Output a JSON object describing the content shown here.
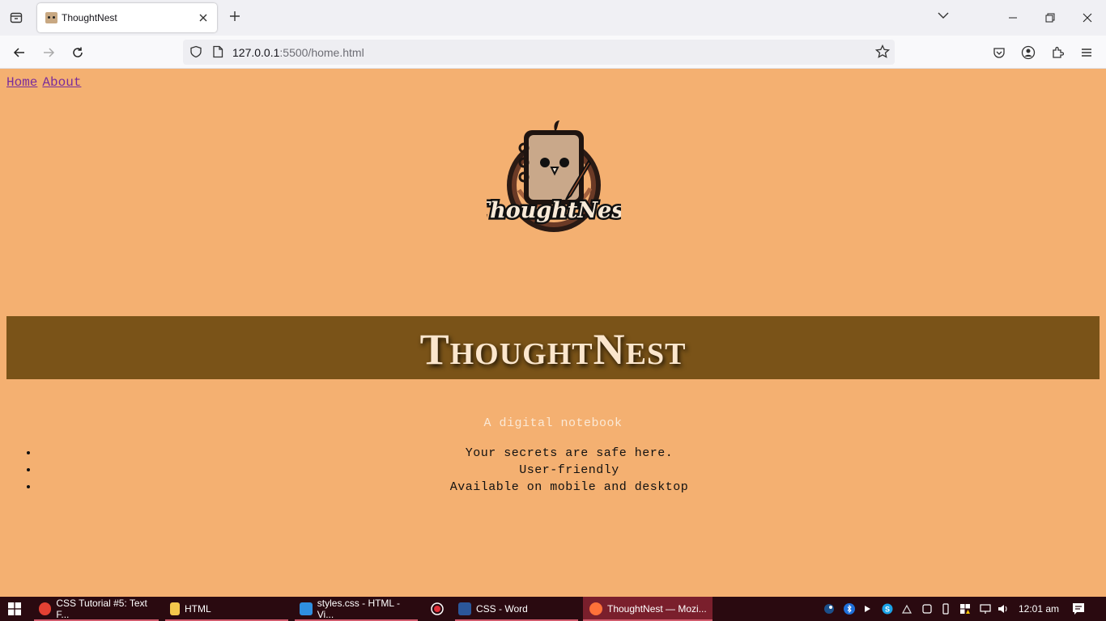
{
  "browser": {
    "tab": {
      "title": "ThoughtNest"
    },
    "url": {
      "host": "127.0.0.1",
      "rest": ":5500/home.html"
    }
  },
  "page": {
    "nav": [
      {
        "label": "Home"
      },
      {
        "label": "About"
      }
    ],
    "logo_text": "ThoughtNest",
    "banner_title": "ThoughtNest",
    "tagline": "A digital notebook",
    "features": [
      "Your secrets are safe here.",
      "User-friendly",
      "Available on mobile and desktop"
    ]
  },
  "taskbar": {
    "items": [
      {
        "label": "CSS Tutorial #5: Text F...",
        "icon": "chrome-icon",
        "color": "#e34133"
      },
      {
        "label": "HTML",
        "icon": "folder-icon",
        "color": "#f4c84c"
      },
      {
        "label": "styles.css - HTML - Vi...",
        "icon": "vscode-icon",
        "color": "#2f8fe0"
      },
      {
        "label": "CSS - Word",
        "icon": "word-icon",
        "color": "#2b579a"
      },
      {
        "label": "ThoughtNest — Mozi...",
        "icon": "firefox-icon",
        "color": "#ff7139"
      }
    ],
    "clock": "12:01 am"
  },
  "colors": {
    "page_bg": "#f4b071",
    "banner_bg": "#7a5318",
    "banner_text": "#fbe6cd",
    "link": "#7a2d9b",
    "taskbar_bg": "#2a0a10"
  }
}
